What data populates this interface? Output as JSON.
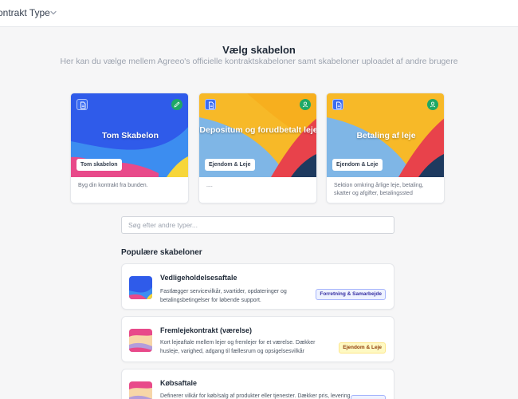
{
  "header": {
    "title": "ontrakt Type"
  },
  "page": {
    "heading": "Vælg skabelon",
    "subheading": "Her kan du vælge mellem Agreeo's officielle kontraktskabeloner samt skabeloner uploadet af andre brugere"
  },
  "templates": [
    {
      "title": "Tom Skabelon",
      "tag": "Tom skabelon",
      "description": "Byg din kontrakt fra bunden.",
      "badge_icon": "pen-icon"
    },
    {
      "title": "Depositum og forudbetalt leje",
      "tag": "Ejendom & Leje",
      "description": "....",
      "badge_icon": "user-icon"
    },
    {
      "title": "Betaling af leje",
      "tag": "Ejendom & Leje",
      "description": "Sektion omkring årlige leje, betaling, skatter og afgifter, betalingssted",
      "badge_icon": "user-icon"
    }
  ],
  "search": {
    "placeholder": "Søg efter andre typer...",
    "value": ""
  },
  "popular": {
    "title": "Populære skabeloner",
    "items": [
      {
        "title": "Vedligeholdelsesaftale",
        "description": "Fastlægger servicevilkår, svartider, opdateringer og betalingsbetingelser for løbende support.",
        "category": "Forretning & Samarbejde"
      },
      {
        "title": "Fremlejekontrakt (værelse)",
        "description": "Kort lejeaftale mellem lejer og fremlejer for et værelse. Dækker husleje, varighed, adgang til fællesrum og opsigelsesvilkår",
        "category": "Ejendom & Leje"
      },
      {
        "title": "Købsaftale",
        "description": "Definerer vilkår for køb/salg af produkter eller tjenester. Dækker pris, levering,",
        "category": ""
      }
    ]
  },
  "colors": {
    "blue": "#2f5bea",
    "yellow": "#f7b928",
    "red": "#e8424b",
    "light_blue": "#7fb6e6",
    "navy": "#1e3a5f",
    "pink": "#e84a8a",
    "green": "#1ea866"
  }
}
